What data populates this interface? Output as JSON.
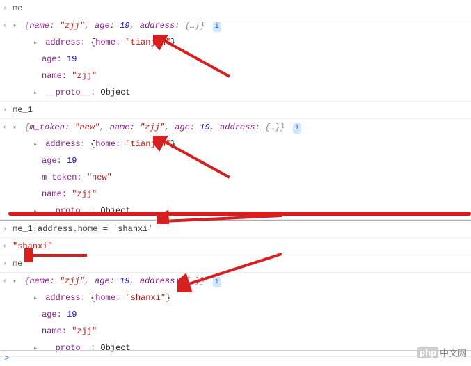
{
  "console": {
    "input1": "me",
    "out1_summary_prefix": "{",
    "out1_summary_name_k": "name:",
    "out1_summary_name_v": "\"zjj\"",
    "out1_summary_age_k": "age:",
    "out1_summary_age_v": "19",
    "out1_summary_addr_k": "address:",
    "out1_summary_addr_v": "{…}",
    "out1_summary_suffix": "}",
    "info_badge": "i",
    "out1_addr_k": "address:",
    "out1_addr_open": "{",
    "out1_addr_home_k": "home:",
    "out1_addr_home_v": "\"tianjin\"",
    "out1_addr_close": "}",
    "out1_age_k": "age:",
    "out1_age_v": "19",
    "out1_name_k": "name:",
    "out1_name_v": "\"zjj\"",
    "out1_proto_k": "__proto__:",
    "out1_proto_v": "Object",
    "input2": "me_1",
    "out2_sum_tok_k": "m_token:",
    "out2_sum_tok_v": "\"new\"",
    "out2_sum_name_k": "name:",
    "out2_sum_name_v": "\"zjj\"",
    "out2_sum_age_k": "age:",
    "out2_sum_age_v": "19",
    "out2_sum_addr_k": "address:",
    "out2_sum_addr_v": "{…}",
    "out2_addr_k": "address:",
    "out2_addr_home_k": "home:",
    "out2_addr_home_v": "\"tianjin\"",
    "out2_age_k": "age:",
    "out2_age_v": "19",
    "out2_tok_k": "m_token:",
    "out2_tok_v": "\"new\"",
    "out2_name_k": "name:",
    "out2_name_v": "\"zjj\"",
    "out2_proto_k": "__proto__:",
    "out2_proto_v": "Object",
    "input3": "me_1.address.home = 'shanxi'",
    "out3": "\"shanxi\"",
    "input4": "me",
    "out4_summary_addr_v": "{…}",
    "out4_addr_k": "address:",
    "out4_addr_home_k": "home:",
    "out4_addr_home_v": "\"shanxi\"",
    "out4_age_k": "age:",
    "out4_age_v": "19",
    "out4_name_k": "name:",
    "out4_name_v": "\"zjj\"",
    "out4_proto_k": "__proto__:",
    "out4_proto_v": "Object",
    "prompt": ">"
  },
  "watermark": {
    "icon": "php",
    "text": "中文网"
  }
}
